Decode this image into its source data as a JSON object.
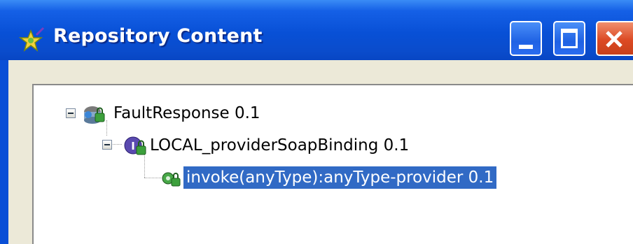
{
  "window": {
    "title": "Repository Content",
    "buttons": {
      "minimize": "minimize-icon",
      "maximize": "maximize-icon",
      "close": "close-icon"
    }
  },
  "tree": {
    "items": [
      {
        "label": "FaultResponse 0.1",
        "icon": "service-icon",
        "expanded": true,
        "selected": false
      },
      {
        "label": "LOCAL_providerSoapBinding 0.1",
        "icon": "binding-icon",
        "expanded": true,
        "selected": false
      },
      {
        "label": "invoke(anyType):anyType-provider 0.1",
        "icon": "operation-icon",
        "selected": true
      }
    ]
  },
  "colors": {
    "titlebar": "#0850d6",
    "selection": "#316ac5",
    "close_button": "#dc4a24"
  }
}
